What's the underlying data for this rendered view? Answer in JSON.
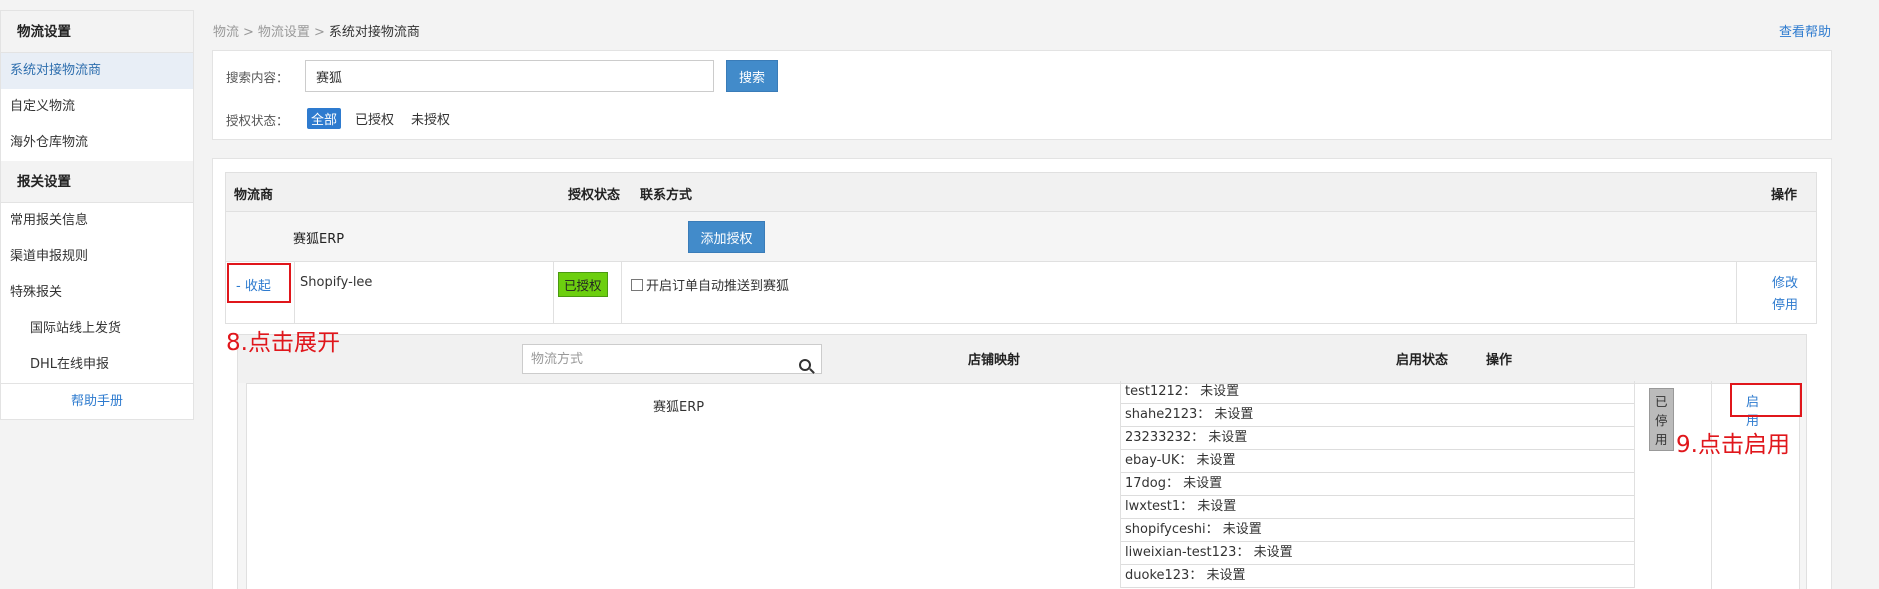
{
  "sidebar": {
    "group1": "物流设置",
    "items1": [
      "系统对接物流商",
      "自定义物流",
      "海外仓库物流"
    ],
    "group2": "报关设置",
    "items2": [
      "常用报关信息",
      "渠道申报规则",
      "特殊报关"
    ],
    "sub_items": [
      "国际站线上发货",
      "DHL在线申报"
    ],
    "help": "帮助手册"
  },
  "breadcrumb": {
    "b1": "物流",
    "b2": "物流设置",
    "b3": "系统对接物流商",
    "sep": ">"
  },
  "help_link": "查看帮助",
  "search": {
    "label": "搜索内容：",
    "value": "赛狐",
    "button": "搜索",
    "auth_label": "授权状态：",
    "options": [
      "全部",
      "已授权",
      "未授权"
    ]
  },
  "table": {
    "headers": {
      "provider": "物流商",
      "auth": "授权状态",
      "contact": "联系方式",
      "op": "操作"
    },
    "group_name": "赛狐ERP",
    "add_auth": "添加授权",
    "row": {
      "collapse": "- 收起",
      "store": "Shopify-lee",
      "auth_status": "已授权",
      "auto_push": "开启订单自动推送到赛狐",
      "edit": "修改",
      "disable": "停用"
    }
  },
  "sub_table": {
    "search_placeholder": "物流方式",
    "headers": {
      "mapping": "店铺映射",
      "status": "启用状态",
      "op": "操作"
    },
    "name": "赛狐ERP",
    "mappings": [
      "test1212：  未设置",
      "shahe2123：  未设置",
      "23233232：  未设置",
      "ebay-UK：  未设置",
      "17dog：  未设置",
      "lwxtest1：  未设置",
      "shopifyceshi：  未设置",
      "liweixian-test123：  未设置",
      "duoke123：  未设置"
    ],
    "status": "已停用",
    "enable": "启用"
  },
  "annotations": {
    "step8": "8.点击展开",
    "step9": "9.点击启用"
  },
  "colors": {
    "accent": "#428bca",
    "link": "#2e7bcf",
    "authorized": "#6ccf0f",
    "annotation": "#e0161b"
  }
}
